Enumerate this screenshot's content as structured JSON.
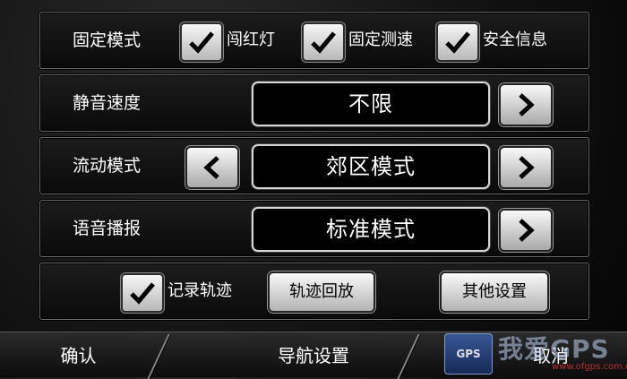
{
  "rows": {
    "fixed_mode": {
      "label": "固定模式",
      "options": [
        {
          "label": "闯红灯",
          "checked": true
        },
        {
          "label": "固定测速",
          "checked": true
        },
        {
          "label": "安全信息",
          "checked": true
        }
      ]
    },
    "mute_speed": {
      "label": "静音速度",
      "value": "不限"
    },
    "mobile_mode": {
      "label": "流动模式",
      "value": "郊区模式"
    },
    "voice_broadcast": {
      "label": "语音播报",
      "value": "标准模式"
    },
    "track": {
      "record_label": "记录轨迹",
      "record_checked": true,
      "playback_button": "轨迹回放",
      "other_settings_button": "其他设置"
    }
  },
  "bottom_bar": {
    "confirm": "确认",
    "nav_settings": "导航设置",
    "cancel": "取消"
  },
  "watermark": {
    "badge": "GPS",
    "brand": "我爱GPS",
    "url": "www.ofgps.com.cn"
  },
  "icons": {
    "check": "check-icon",
    "next": "chevron-right-icon",
    "prev": "chevron-left-icon"
  }
}
